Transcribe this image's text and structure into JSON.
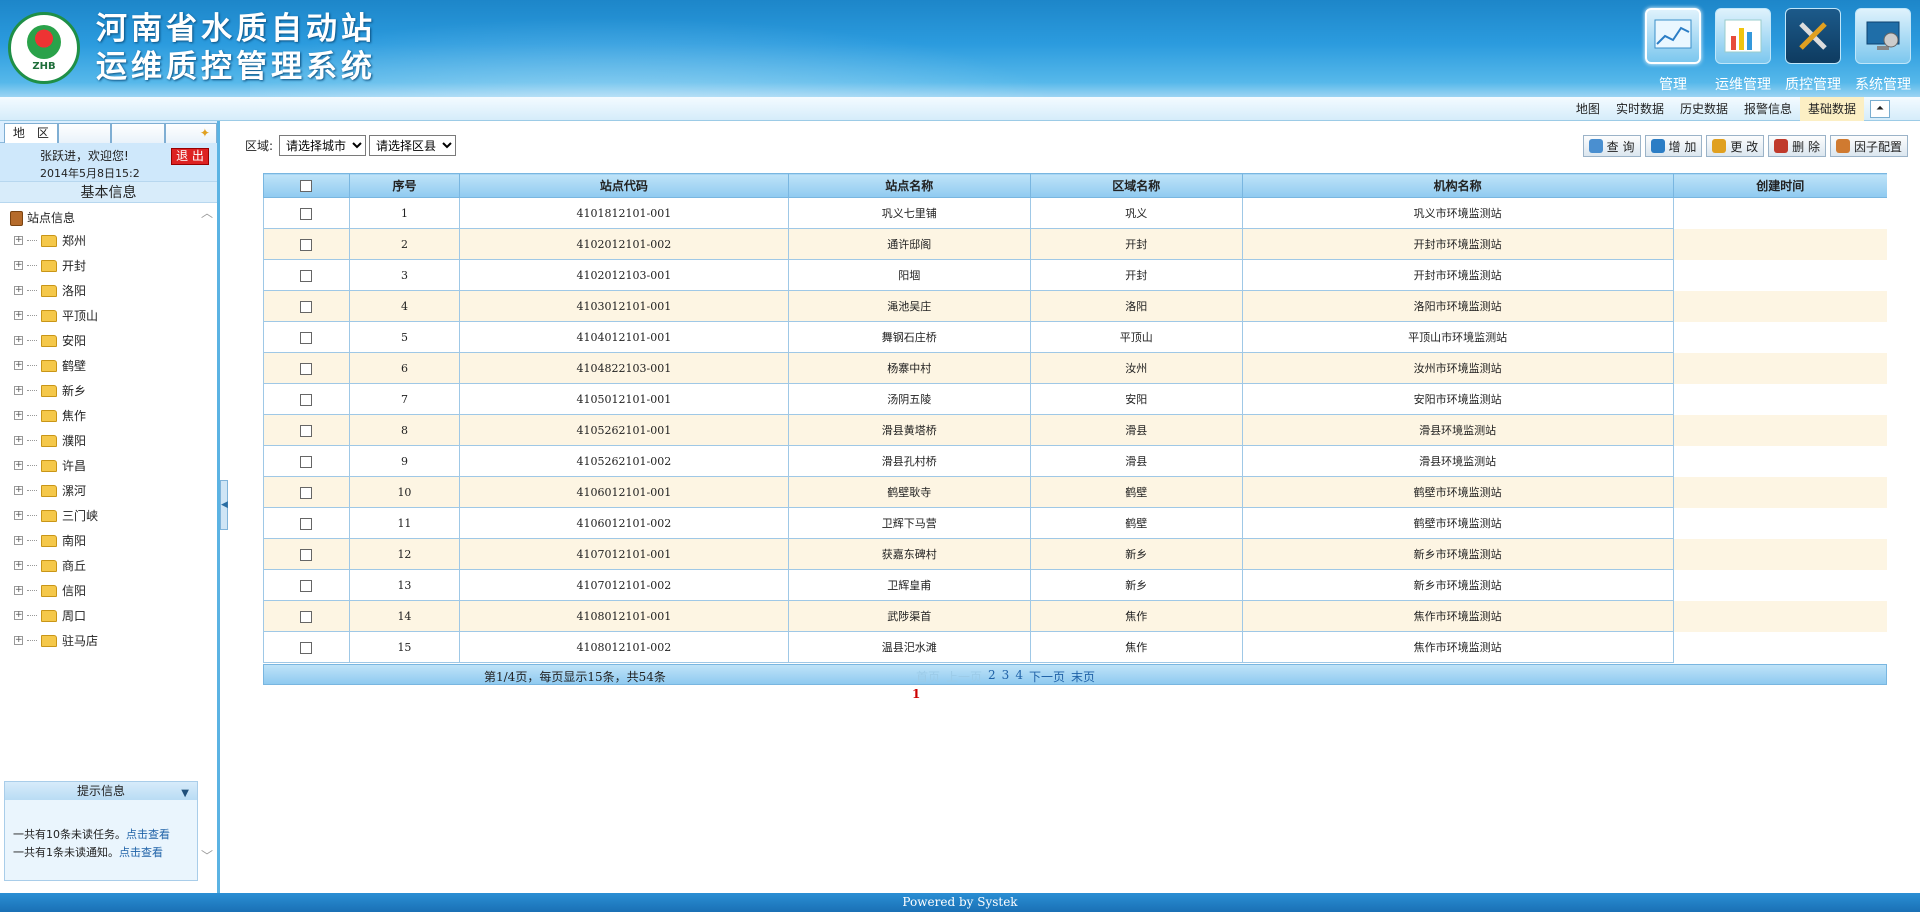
{
  "header": {
    "title_line1": "河南省水质自动站",
    "title_line2": "运维质控管理系统",
    "logo_text": "ZHB",
    "nav": [
      {
        "label": "管理",
        "icon": "chart-screen-icon",
        "active": true
      },
      {
        "label": "运维管理",
        "icon": "bar-chart-icon",
        "active": false
      },
      {
        "label": "质控管理",
        "icon": "tools-icon",
        "active": false
      },
      {
        "label": "系统管理",
        "icon": "computer-gear-icon",
        "active": false
      }
    ]
  },
  "subnav": {
    "items": [
      "地图",
      "实时数据",
      "历史数据",
      "报警信息",
      "基础数据"
    ],
    "selected": "基础数据"
  },
  "sidebar": {
    "tab_label": "地　区",
    "welcome": "张跃进，欢迎您!",
    "date": "2014年5月8日15:2",
    "logout": "退 出",
    "section_title": "基本信息",
    "tree_root": "站点信息",
    "cities": [
      "郑州",
      "开封",
      "洛阳",
      "平顶山",
      "安阳",
      "鹤壁",
      "新乡",
      "焦作",
      "濮阳",
      "许昌",
      "漯河",
      "三门峡",
      "南阳",
      "商丘",
      "信阳",
      "周口",
      "驻马店"
    ],
    "tip_title": "提示信息",
    "tip1_text": "一共有10条未读任务。",
    "tip2_text": "一共有1条未读通知。",
    "tip_link": "点击查看"
  },
  "filters": {
    "label": "区域:",
    "city_select": "请选择城市",
    "county_select": "请选择区县"
  },
  "actions": [
    {
      "label": "查 询",
      "icon": "search-icon",
      "color": "#4a8fd0"
    },
    {
      "label": "增 加",
      "icon": "add-icon",
      "color": "#2b7dc5"
    },
    {
      "label": "更 改",
      "icon": "edit-icon",
      "color": "#e0a020"
    },
    {
      "label": "删 除",
      "icon": "delete-icon",
      "color": "#c0392b"
    },
    {
      "label": "因子配置",
      "icon": "config-icon",
      "color": "#d07a30"
    }
  ],
  "table": {
    "columns": [
      "序号",
      "站点代码",
      "站点名称",
      "区域名称",
      "机构名称",
      "创建时间"
    ],
    "rows": [
      [
        "1",
        "4101812101-001",
        "巩义七里铺",
        "巩义",
        "巩义市环境监测站",
        ""
      ],
      [
        "2",
        "4102012101-002",
        "通许邸阁",
        "开封",
        "开封市环境监测站",
        ""
      ],
      [
        "3",
        "4102012103-001",
        "阳堌",
        "开封",
        "开封市环境监测站",
        ""
      ],
      [
        "4",
        "4103012101-001",
        "渑池吴庄",
        "洛阳",
        "洛阳市环境监测站",
        ""
      ],
      [
        "5",
        "4104012101-001",
        "舞钢石庄桥",
        "平顶山",
        "平顶山市环境监测站",
        ""
      ],
      [
        "6",
        "4104822103-001",
        "杨寨中村",
        "汝州",
        "汝州市环境监测站",
        ""
      ],
      [
        "7",
        "4105012101-001",
        "汤阴五陵",
        "安阳",
        "安阳市环境监测站",
        ""
      ],
      [
        "8",
        "4105262101-001",
        "滑县黄塔桥",
        "滑县",
        "滑县环境监测站",
        ""
      ],
      [
        "9",
        "4105262101-002",
        "滑县孔村桥",
        "滑县",
        "滑县环境监测站",
        ""
      ],
      [
        "10",
        "4106012101-001",
        "鹤壁耿寺",
        "鹤壁",
        "鹤壁市环境监测站",
        ""
      ],
      [
        "11",
        "4106012101-002",
        "卫辉下马营",
        "鹤壁",
        "鹤壁市环境监测站",
        ""
      ],
      [
        "12",
        "4107012101-001",
        "获嘉东碑村",
        "新乡",
        "新乡市环境监测站",
        ""
      ],
      [
        "13",
        "4107012101-002",
        "卫辉皇甫",
        "新乡",
        "新乡市环境监测站",
        ""
      ],
      [
        "14",
        "4108012101-001",
        "武陟渠首",
        "焦作",
        "焦作市环境监测站",
        ""
      ],
      [
        "15",
        "4108012101-002",
        "温县汜水滩",
        "焦作",
        "焦作市环境监测站",
        ""
      ]
    ]
  },
  "pager": {
    "info": "第1/4页，每页显示15条，共54条",
    "first": "首页",
    "prev": "上一页",
    "pages": [
      "2",
      "3",
      "4"
    ],
    "next": "下一页",
    "last": "末页",
    "current": "1"
  },
  "footer": {
    "text": "Powered by Systek"
  }
}
